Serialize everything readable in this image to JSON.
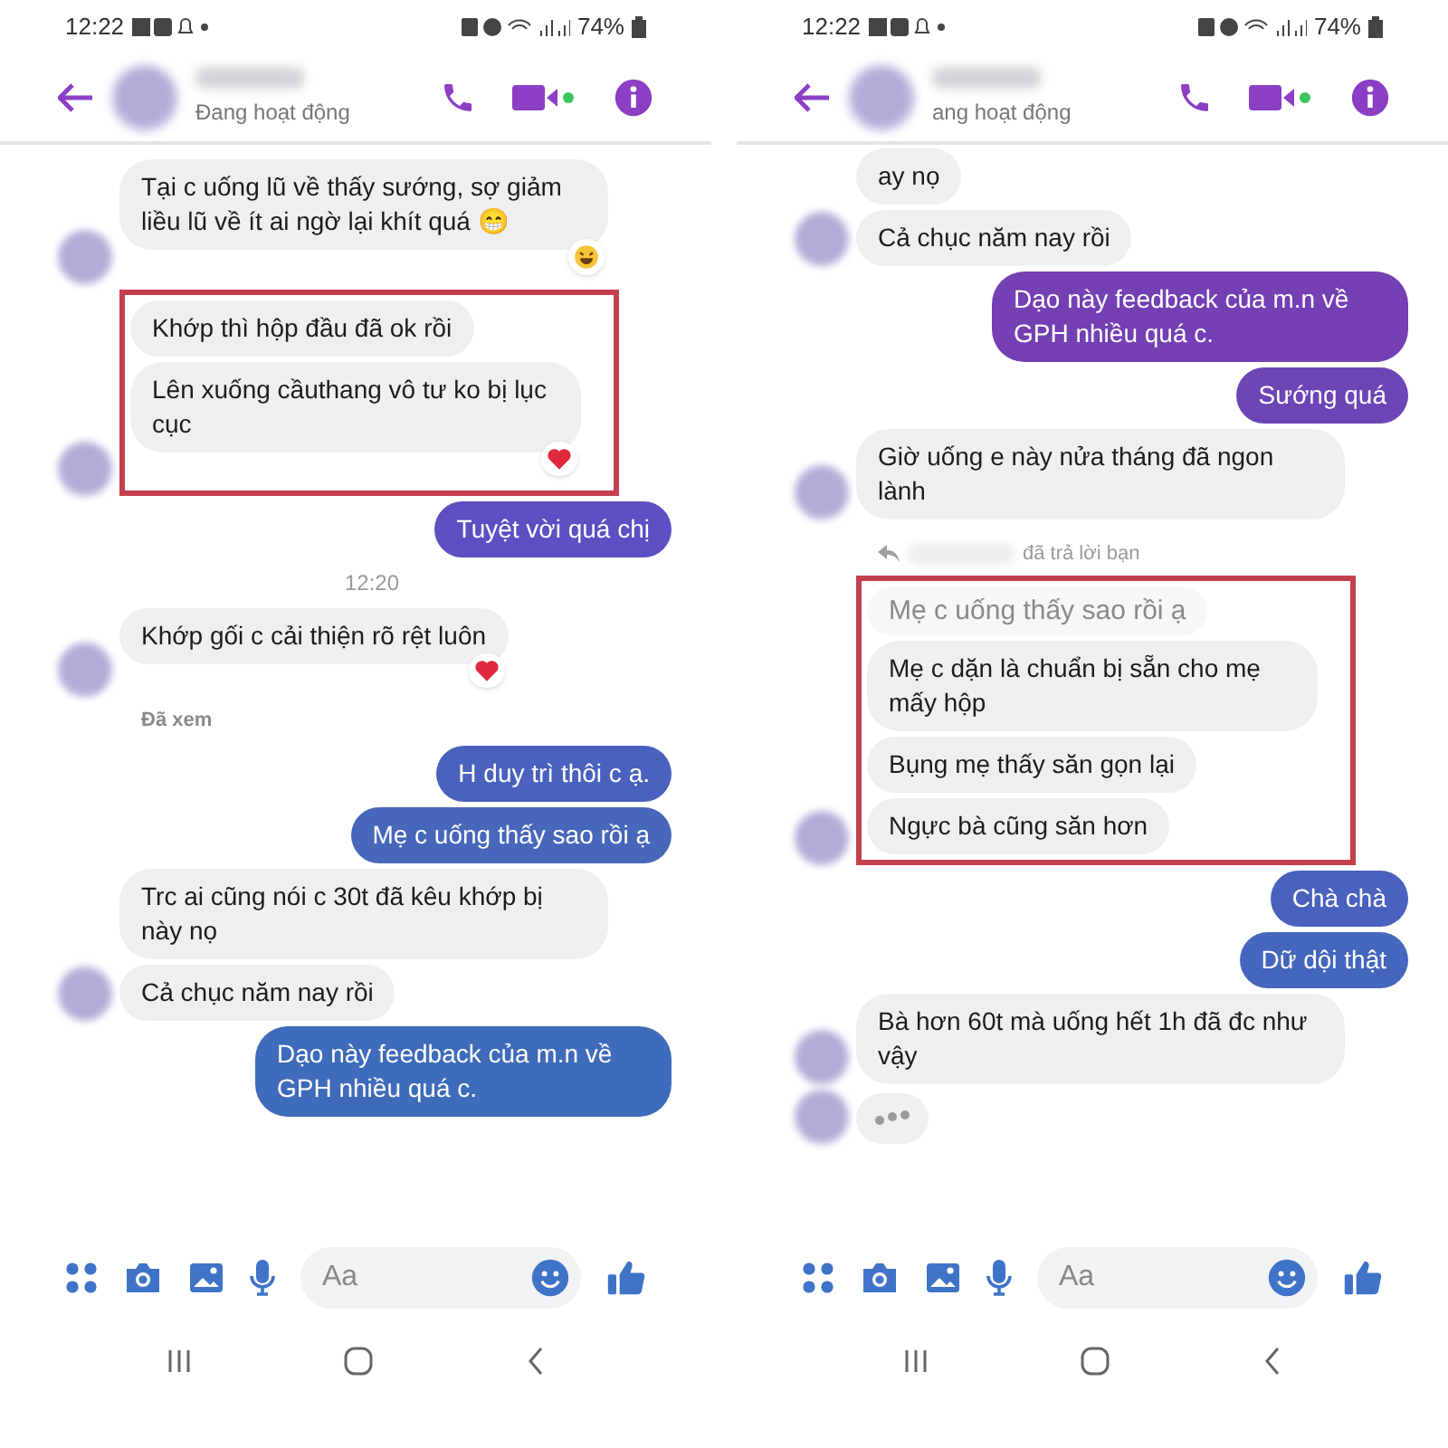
{
  "screens": [
    {
      "status_bar": {
        "time": "12:22",
        "battery": "74%"
      },
      "header": {
        "subtitle": "Đang hoạt động"
      },
      "messages": [
        {
          "kind": "received",
          "text": "Tại c uống lũ về thấy sướng, sợ giảm liều lũ về ít ai ngờ lại khít quá 😁",
          "laughed": true,
          "avatar": true
        },
        {
          "kind": "highlight",
          "messages": [
            {
              "kind": "received",
              "text": "Khớp thì hộp đầu đã ok rồi"
            },
            {
              "kind": "received",
              "text": "Lên xuống cầuthang vô tư ko bị lục cục",
              "hearted": true,
              "avatar": true
            }
          ]
        },
        {
          "kind": "sent",
          "text": "Tuyệt vời quá chị",
          "color": "#5c50c2"
        },
        {
          "kind": "timestamp",
          "text": "12:20"
        },
        {
          "kind": "received",
          "text": "Khớp gối c cải thiện rõ rệt luôn",
          "hearted": true,
          "avatar": true
        },
        {
          "kind": "seen",
          "text": "Đã xem"
        },
        {
          "kind": "sent",
          "text": "H duy trì thôi c ạ.",
          "color": "#4a62bd"
        },
        {
          "kind": "sent",
          "text": "Mẹ c uống thấy sao rồi ạ",
          "color": "#4767bb"
        },
        {
          "kind": "received",
          "text": "Trc ai cũng nói c 30t đã kêu khớp bị này nọ"
        },
        {
          "kind": "received",
          "text": "Cả chục năm nay rồi",
          "avatar": true
        },
        {
          "kind": "sent",
          "text": "Dạo này feedback của m.n về GPH nhiều quá c.",
          "color": "#3f6cba"
        }
      ],
      "composer": {
        "placeholder": "Aa"
      }
    },
    {
      "status_bar": {
        "time": "12:22",
        "battery": "74%"
      },
      "header": {
        "subtitle": "ang hoạt động"
      },
      "messages": [
        {
          "kind": "received",
          "text": "ay nọ"
        },
        {
          "kind": "received",
          "text": "Cả chục năm nay rồi",
          "avatar": true
        },
        {
          "kind": "sent",
          "text": "Dạo này feedback của m.n về GPH nhiều quá c.",
          "color": "#7440b3"
        },
        {
          "kind": "sent",
          "text": "Sướng quá",
          "color": "#6d46b6"
        },
        {
          "kind": "received",
          "text": "Giờ uống e này nửa tháng đã ngon lành",
          "avatar": true
        },
        {
          "kind": "reply_note",
          "text": "đã trả lời bạn"
        },
        {
          "kind": "highlight",
          "messages": [
            {
              "kind": "quote",
              "text": "Mẹ c uống thấy sao rồi ạ"
            },
            {
              "kind": "received",
              "text": "Mẹ c dặn là chuẩn bị sẵn cho mẹ mấy hộp"
            },
            {
              "kind": "received",
              "text": "Bụng mẹ thấy săn gọn lại"
            },
            {
              "kind": "received",
              "text": "Ngực bà cũng săn hơn",
              "avatar": true
            }
          ]
        },
        {
          "kind": "sent",
          "text": "Chà chà",
          "color": "#4a62bd"
        },
        {
          "kind": "sent",
          "text": "Dữ dội thật",
          "color": "#4466bc"
        },
        {
          "kind": "received",
          "text": "Bà hơn 60t mà uống hết 1h đã đc như vậy",
          "avatar": true
        },
        {
          "kind": "typing",
          "avatar": true
        }
      ],
      "composer": {
        "placeholder": "Aa"
      }
    }
  ]
}
